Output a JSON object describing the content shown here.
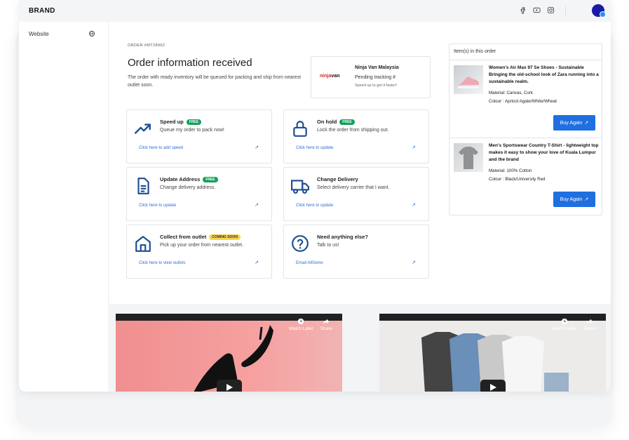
{
  "header": {
    "brand": "BRAND",
    "social_icons": [
      "facebook-icon",
      "youtube-icon",
      "instagram-icon"
    ],
    "avatar": "avatar"
  },
  "sidebar": {
    "items": [
      {
        "label": "Website",
        "icon": "globe-icon"
      }
    ]
  },
  "order": {
    "number": "ORDER #MT28962",
    "title": "Order information received",
    "subtitle": "The order with ready inventory will be queued for packing and ship from nearest outlet soon."
  },
  "courier": {
    "logo_prefix": "",
    "logo_accent": "ninja",
    "logo_suffix": "van",
    "name": "Ninja Van Malaysia",
    "status": "Pending tracking #",
    "hint": "Speed up to get it faster!"
  },
  "cards": [
    {
      "title": "Speed up",
      "badge": "FREE",
      "desc": "Queue my order to pack now!",
      "link": "Click here to add speed",
      "icon": "trending-up-icon"
    },
    {
      "title": "On hold",
      "badge": "FREE",
      "desc": "Lock the order from shipping out.",
      "link": "Click here to update",
      "icon": "lock-icon"
    },
    {
      "title": "Update Address",
      "badge": "FREE",
      "desc": "Change delivery address.",
      "link": "Click here to update",
      "icon": "document-icon"
    },
    {
      "title": "Change Delivery",
      "badge": "",
      "desc": "Select delivery carrier that I want.",
      "link": "Click here to update",
      "icon": "truck-icon"
    },
    {
      "title": "Collect from outlet",
      "badge": "COMING SOON",
      "desc": "Pick up your order from nearest outlet.",
      "link": "Click here to view outlets",
      "icon": "home-icon"
    },
    {
      "title": "Need anything else?",
      "badge": "",
      "desc": "Talk to us!",
      "link": "Email AllSome",
      "icon": "help-circle-icon"
    }
  ],
  "items_panel": {
    "heading": "Item(s) in this order",
    "items": [
      {
        "name": "Women's Air Max 97 Se Shoes - Sustainable Bringing the old-school look of Zara running into a sustainable realm.",
        "material": "Material: Canvas, Cork",
        "colour": "Colour : Apricot Agate/White/Wheat",
        "button": "Buy Again"
      },
      {
        "name": "Men's Sportswear Country T-Shirt - lightweight top makes it easy to show your love of Kuala Lumpur and the brand",
        "material": "Material: 100% Cotton",
        "colour": "Colour : Black/University Red",
        "button": "Buy Again"
      }
    ]
  },
  "videos": [
    {
      "watch_later": "Watch Later",
      "share": "Share"
    },
    {
      "watch_later": "Watch Later",
      "share": "Share"
    }
  ],
  "arrow_glyph": "↗",
  "colors": {
    "accent": "#1f6fe0",
    "link": "#2c6fd6",
    "badge_free": "#12a15a",
    "badge_soon": "#f7d548",
    "icon": "#1d4f91"
  }
}
